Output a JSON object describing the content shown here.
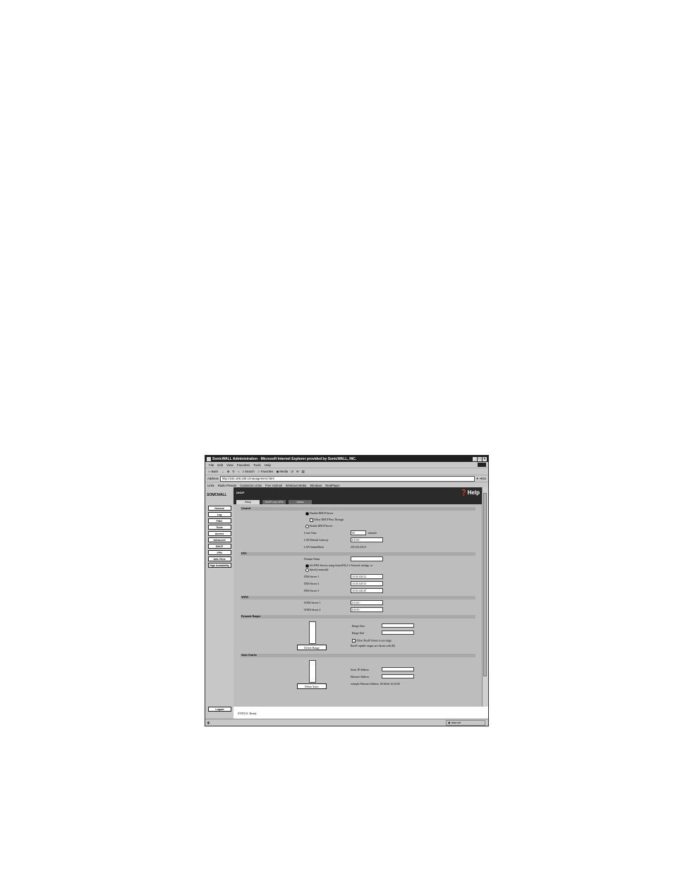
{
  "window": {
    "title": "SonicWALL Administration - Microsoft Internet Explorer provided by SonicWALL, INC."
  },
  "menu": [
    "File",
    "Edit",
    "View",
    "Favorites",
    "Tools",
    "Help"
  ],
  "toolbar": {
    "back": "Back",
    "forward": "→",
    "search": "Search",
    "favorites": "Favorites",
    "media": "Media"
  },
  "address": {
    "label": "Address",
    "url": "http://192.168.168.1/management.html",
    "go": "Go"
  },
  "links": {
    "label": "Links",
    "items": [
      "Radio Presets",
      "Customize Links",
      "Free Hotmail",
      "Windows Media",
      "Windows",
      "RealPlayer"
    ]
  },
  "sidebar": {
    "logo": "SONICWALL",
    "items": [
      "General",
      "Log",
      "Filter",
      "Tools",
      "Access",
      "Advanced",
      "DHCP",
      "VPN",
      "Anti-Virus",
      "High Availability"
    ],
    "logout": "Logout"
  },
  "header": {
    "title": "DHCP",
    "help": "Help"
  },
  "tabs": [
    "Setup",
    "DHCP over VPN",
    "Status"
  ],
  "general": {
    "section": "General",
    "disable": "Disable DHCP Server",
    "passthrough": "Allow DHCP Pass Through",
    "enable": "Enable DHCP Server",
    "lease_label": "Lease Time",
    "lease_value": "60",
    "lease_unit": "minutes",
    "gateway_label": "LAN Default Gateway",
    "gateway_value": "0.0.0.0",
    "mask_label": "LAN SubnetMask",
    "mask_value": "255.255.255.0"
  },
  "dns": {
    "section": "DNS",
    "domain_label": "Domain Name",
    "domain_value": "",
    "opt_auto": "Set DNS Servers using SonicWALL's Network settings, or",
    "opt_manual": "Specify manually",
    "s1_label": "DNS Server 1",
    "s1_value": "10.50.128.52",
    "s2_label": "DNS Server 2",
    "s2_value": "10.50.128.53",
    "s3_label": "DNS Server 3",
    "s3_value": "10.50.128.29"
  },
  "wins": {
    "section": "WINS",
    "w1_label": "WINS Server 1",
    "w1_value": "0.0.0.0",
    "w2_label": "WINS Server 2",
    "w2_value": "0.0.0.0"
  },
  "dynamic": {
    "section": "Dynamic Ranges",
    "start_label": "Range Start",
    "end_label": "Range End",
    "bootp": "Allow BootP clients to use range",
    "note": "BootP capable ranges are shown with (B)",
    "delete": "Delete Range"
  },
  "static": {
    "section": "Static Entries",
    "ip_label": "Static IP Address",
    "mac_label": "Ethernet Address",
    "example": "example Ethernet Address: 00:40:eb:12:34:56",
    "delete": "Delete Static"
  },
  "status": {
    "text": "STATUS: Ready",
    "zone": "Internet"
  }
}
